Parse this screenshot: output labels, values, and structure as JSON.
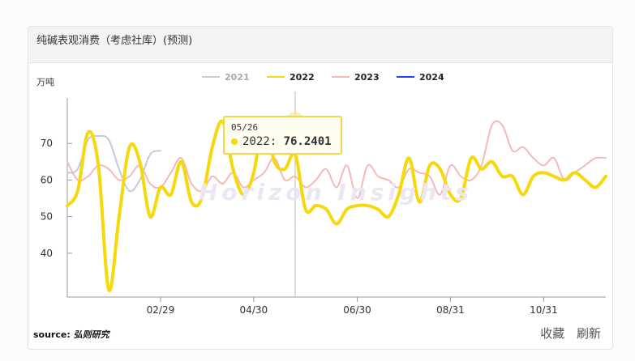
{
  "card": {
    "title": "纯碱表观消费（考虑社库）(预测)",
    "source_label": "source:",
    "source_name": "弘则研究",
    "actions": {
      "favorite": "收藏",
      "refresh": "刷新"
    }
  },
  "watermark": "Horizon Insights",
  "tooltip": {
    "date": "05/26",
    "series": "2022",
    "value": "76.2401"
  },
  "chart_data": {
    "type": "line",
    "ylabel": "万吨",
    "ylim": [
      28,
      82
    ],
    "yticks": [
      40,
      50,
      60,
      70
    ],
    "x_range": [
      0,
      52
    ],
    "xticks": [
      {
        "label": "02/29",
        "x": 9
      },
      {
        "label": "04/30",
        "x": 18
      },
      {
        "label": "06/30",
        "x": 28
      },
      {
        "label": "08/31",
        "x": 37
      },
      {
        "label": "10/31",
        "x": 46
      }
    ],
    "grid": false,
    "legend": "top-center",
    "hover_x": 22,
    "series": [
      {
        "name": "2021",
        "color": "#c9cdd8",
        "dashed": false,
        "x": [
          0,
          1,
          2,
          3,
          4,
          5,
          6,
          7,
          8,
          9
        ],
        "y": [
          62,
          63,
          71,
          72,
          71,
          63,
          57,
          60,
          67,
          68
        ]
      },
      {
        "name": "2022",
        "color": "#f5d90a",
        "highlighted": true,
        "x": [
          0,
          1,
          2,
          3,
          4,
          5,
          6,
          7,
          8,
          9,
          10,
          11,
          12,
          13,
          14,
          15,
          16,
          17,
          18,
          19,
          20,
          21,
          22,
          23,
          24,
          25,
          26,
          27,
          28,
          29,
          30,
          31,
          32,
          33,
          34,
          35,
          36,
          37,
          38,
          39,
          40,
          41,
          42,
          43,
          44,
          45,
          46,
          47,
          48,
          49,
          50,
          51,
          52
        ],
        "y": [
          53,
          57,
          73,
          64,
          30,
          50,
          69,
          65,
          50,
          58,
          56,
          65,
          54,
          55,
          69,
          76,
          63,
          56,
          62,
          76.2401,
          65,
          63,
          67,
          52,
          53,
          52,
          48,
          52,
          53,
          53,
          52,
          50,
          56,
          66,
          54,
          64,
          63,
          56,
          55,
          66,
          63,
          65,
          61,
          61,
          56,
          61,
          62,
          61,
          60,
          62,
          60,
          58,
          61
        ]
      },
      {
        "name": "2023",
        "color": "#f4b9b9",
        "x": [
          0,
          1,
          2,
          3,
          4,
          5,
          6,
          7,
          8,
          9,
          10,
          11,
          12,
          13,
          14,
          15,
          16,
          17,
          18,
          19,
          20,
          21,
          22,
          23,
          24,
          25,
          26,
          27,
          28,
          29,
          30,
          31,
          32,
          33,
          34,
          35,
          36,
          37,
          38,
          39,
          40,
          41,
          42,
          43,
          44,
          45,
          46,
          47,
          48,
          49,
          50,
          51,
          52
        ],
        "y": [
          65,
          60,
          61,
          64,
          63,
          60,
          61,
          64,
          59,
          58,
          62,
          66,
          59,
          57,
          61,
          59,
          62,
          58,
          60,
          62,
          66,
          60,
          61,
          58,
          60,
          63,
          58,
          64,
          55,
          64,
          61,
          60,
          58,
          63,
          62,
          61,
          56,
          64,
          61,
          60,
          64,
          75,
          75,
          68,
          69,
          66,
          64,
          66,
          60,
          62,
          64,
          66,
          66
        ]
      },
      {
        "name": "2024",
        "color": "#1f3fff",
        "x": [],
        "y": []
      }
    ]
  }
}
